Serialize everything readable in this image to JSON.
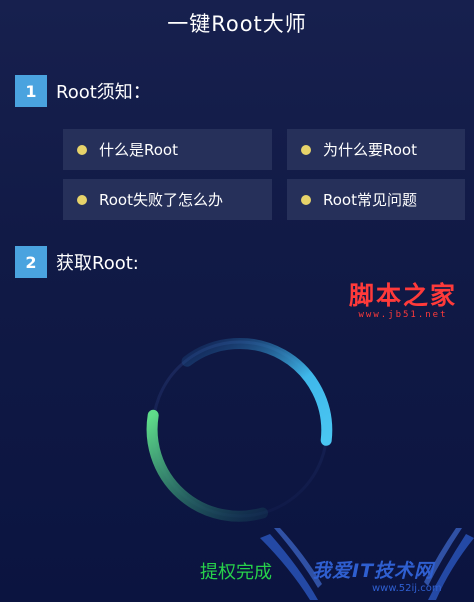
{
  "app": {
    "title": "一键Root大师"
  },
  "section1": {
    "number": "1",
    "label": "Root须知：",
    "items": [
      {
        "label": "什么是Root"
      },
      {
        "label": "为什么要Root"
      },
      {
        "label": "Root失败了怎么办"
      },
      {
        "label": "Root常见问题"
      }
    ]
  },
  "section2": {
    "number": "2",
    "label": "获取Root:"
  },
  "progress": {
    "status": "提权完成",
    "value": 1.0
  },
  "watermarks": {
    "top_brand": "脚本之家",
    "top_url": "www.jb51.net",
    "bottom_brand": "我爱IT技术网",
    "bottom_url": "www.52ij.com"
  },
  "colors": {
    "accent": "#4aa3df",
    "bullet": "#e7d36a",
    "status_green": "#27d14a",
    "ring_blue": "#3fb8ea",
    "ring_green": "#5fdc8a"
  }
}
